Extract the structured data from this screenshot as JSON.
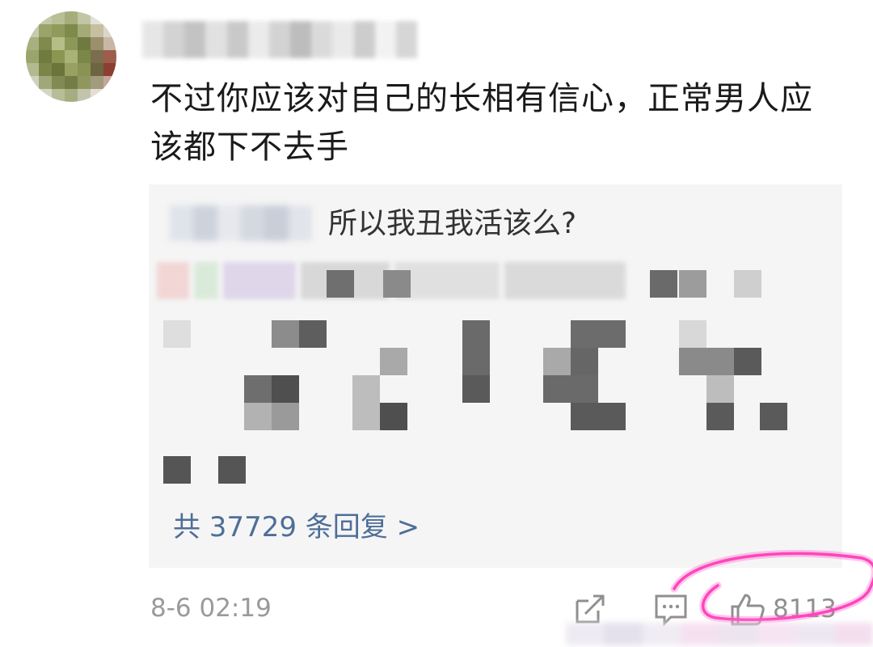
{
  "comment": {
    "text": "不过你应该对自己的长相有信心，正常男人应该都下不去手",
    "timestamp": "8-6 02:19",
    "like_count": "8113"
  },
  "reply": {
    "first_text": "所以我丑我活该么?",
    "total_label": "共 37729 条回复 >"
  },
  "icons": {
    "share": "share-icon",
    "comment": "comment-icon",
    "like": "thumbs-up-icon"
  },
  "colors": {
    "link": "#4e6e98",
    "text": "#1a1a1a",
    "meta": "#9a9a9a",
    "reply_bg": "#f5f5f5",
    "highlight": "#ff5fc8"
  }
}
